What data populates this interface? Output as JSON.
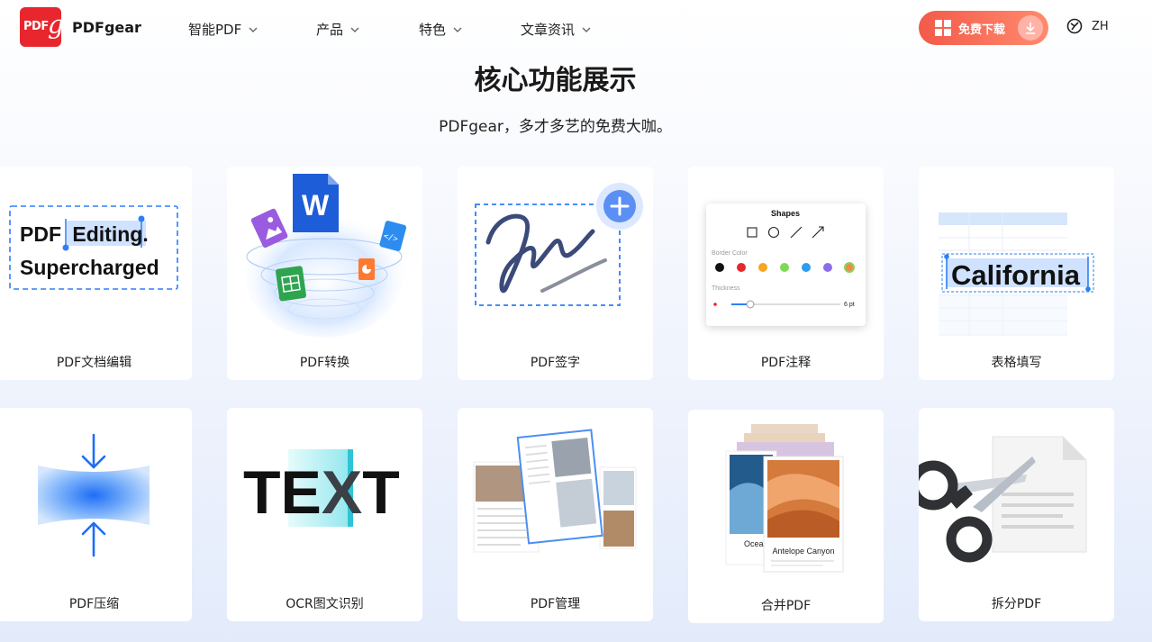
{
  "brand": {
    "logo_text": "PDFgear",
    "logo_letters": "PDF",
    "logo_glyph": "g"
  },
  "nav": {
    "items": [
      {
        "label": "智能PDF"
      },
      {
        "label": "产品"
      },
      {
        "label": "特色"
      },
      {
        "label": "文章资讯"
      }
    ],
    "download_label": "免费下载",
    "lang_label": "ZH"
  },
  "hero": {
    "title": "核心功能展示",
    "subtitle": "PDFgear，多才多艺的免费大咖。"
  },
  "cards": [
    {
      "label": "PDF文档编辑",
      "art": {
        "line1_a": "PDF",
        "line1_b": "Editing",
        "line1_c": ".",
        "line2": "Supercharged"
      }
    },
    {
      "label": "PDF转换",
      "art": {
        "word_letter": "W",
        "code_text": "</>"
      }
    },
    {
      "label": "PDF签字"
    },
    {
      "label": "PDF注释",
      "art": {
        "panel_title": "Shapes",
        "border_color_label": "Border Color",
        "thickness_label": "Thickness",
        "thickness_value": "6 pt",
        "swatches": [
          "#111111",
          "#e8262d",
          "#f5a623",
          "#7ed957",
          "#2d9cf0",
          "#8e6ee8"
        ]
      }
    },
    {
      "label": "表格填写",
      "art": {
        "cell_text": "California"
      }
    },
    {
      "label": "PDF压缩"
    },
    {
      "label": "OCR图文识别",
      "art": {
        "text_a": "TE",
        "text_b": "X",
        "text_c": "T"
      }
    },
    {
      "label": "PDF管理"
    },
    {
      "label": "合并PDF",
      "art": {
        "photo_back_label": "Ocea",
        "photo_front_label": "Antelope Canyon"
      }
    },
    {
      "label": "拆分PDF"
    }
  ],
  "colors": {
    "accent": "#1677ff",
    "download_start": "#f35a4a",
    "download_end": "#ff8a6e",
    "brand_red": "#e8262d"
  }
}
